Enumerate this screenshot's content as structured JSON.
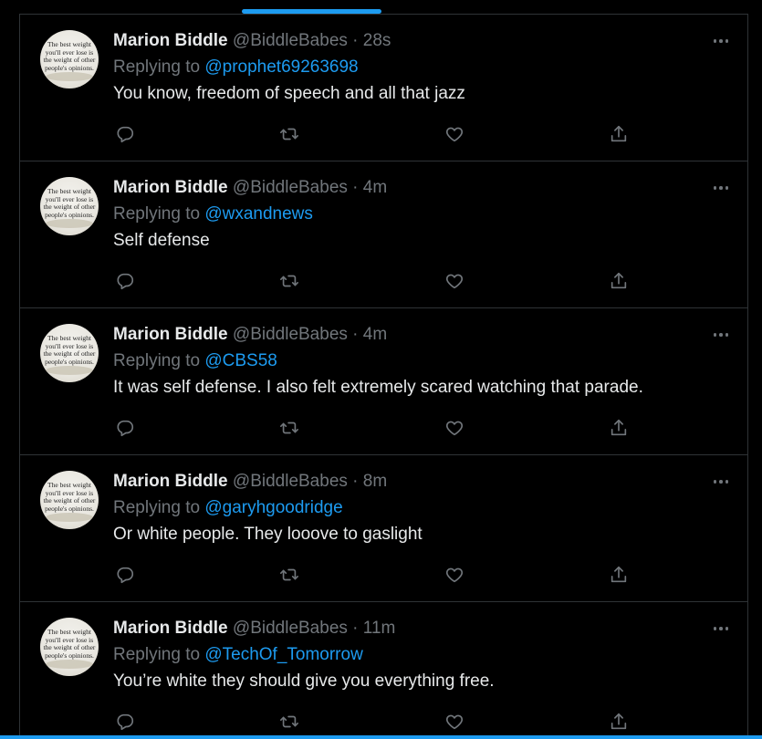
{
  "colors": {
    "background": "#000000",
    "accent": "#1d9bf0",
    "primary_text": "#e7e9ea",
    "secondary_text": "#71767b",
    "divider": "#2f3336"
  },
  "avatar_text": "The best weight\nyou'll ever lose is\nthe weight of other\npeople's opinions.",
  "tweets": [
    {
      "name": "Marion Biddle",
      "handle": "@BiddleBabes",
      "separator": "·",
      "time": "28s",
      "replying_to_label": "Replying to",
      "mention": "@prophet69263698",
      "text": "You know, freedom of speech and all that jazz"
    },
    {
      "name": "Marion Biddle",
      "handle": "@BiddleBabes",
      "separator": "·",
      "time": "4m",
      "replying_to_label": "Replying to",
      "mention": "@wxandnews",
      "text": "Self defense"
    },
    {
      "name": "Marion Biddle",
      "handle": "@BiddleBabes",
      "separator": "·",
      "time": "4m",
      "replying_to_label": "Replying to",
      "mention": "@CBS58",
      "text": "It was self defense. I also felt extremely scared watching that parade."
    },
    {
      "name": "Marion Biddle",
      "handle": "@BiddleBabes",
      "separator": "·",
      "time": "8m",
      "replying_to_label": "Replying to",
      "mention": "@garyhgoodridge",
      "text": "Or white people. They looove to gaslight"
    },
    {
      "name": "Marion Biddle",
      "handle": "@BiddleBabes",
      "separator": "·",
      "time": "11m",
      "replying_to_label": "Replying to",
      "mention": "@TechOf_Tomorrow",
      "text": "You’re white they should give you everything free."
    }
  ],
  "icons": {
    "more": "more-horizontal-icon",
    "reply": "reply-icon",
    "retweet": "retweet-icon",
    "like": "heart-icon",
    "share": "share-icon"
  }
}
